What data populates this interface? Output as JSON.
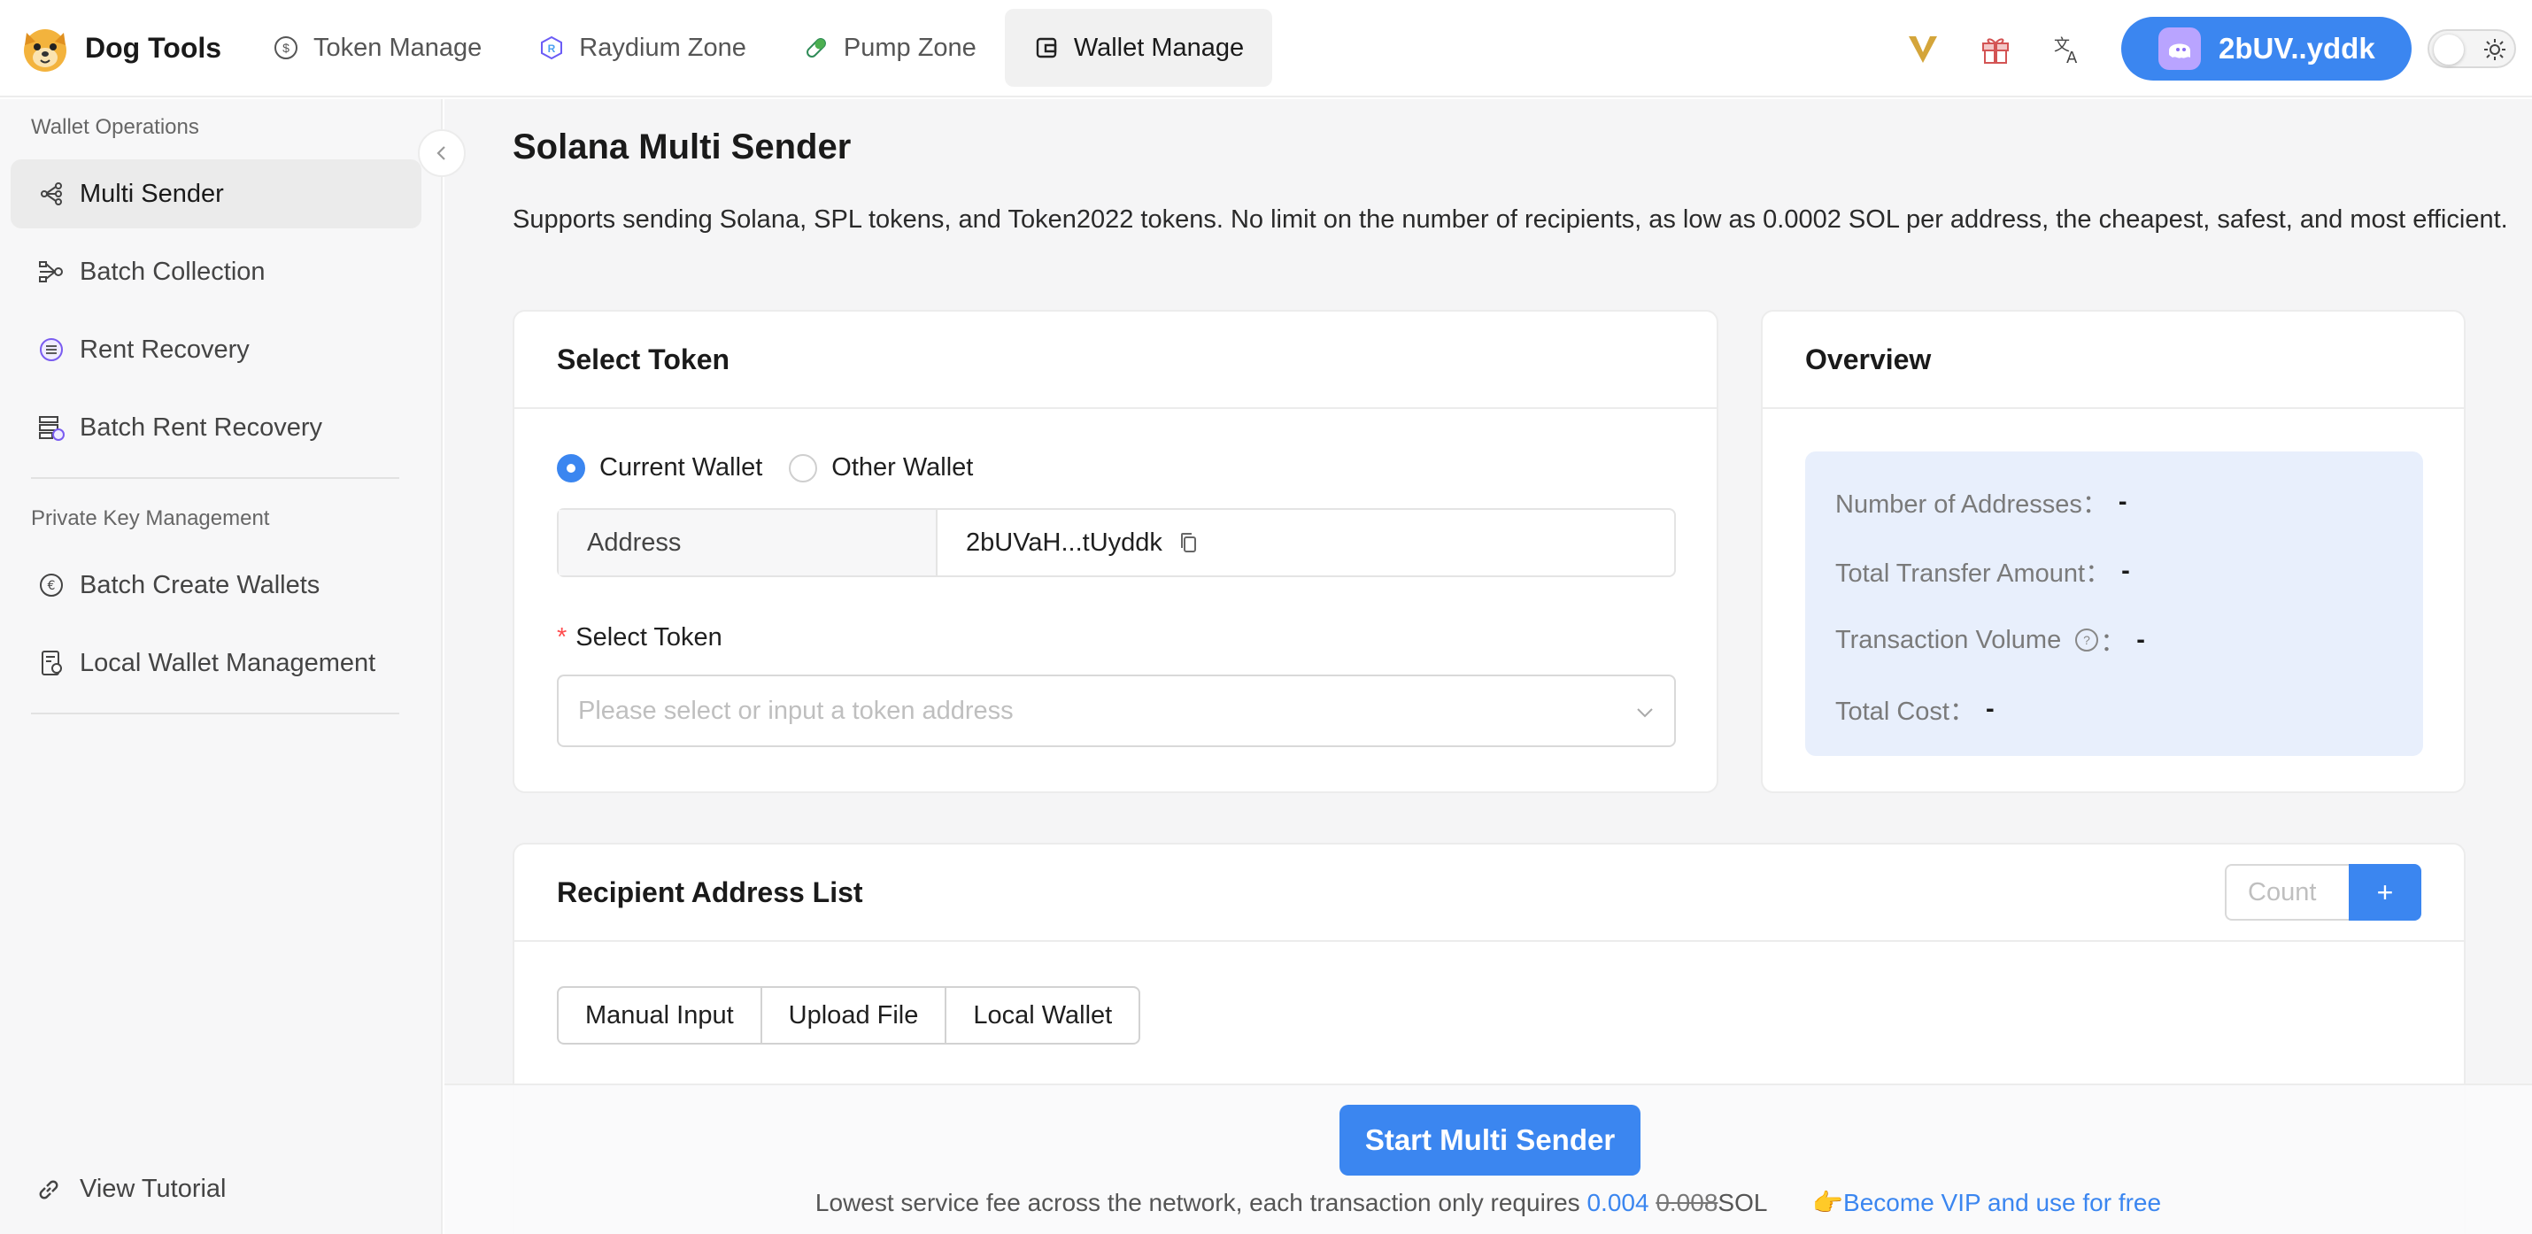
{
  "app": {
    "name": "Dog Tools"
  },
  "nav": [
    {
      "label": "Token Manage",
      "icon": "dollar-icon"
    },
    {
      "label": "Raydium Zone",
      "icon": "raydium-icon"
    },
    {
      "label": "Pump Zone",
      "icon": "pill-icon"
    },
    {
      "label": "Wallet Manage",
      "icon": "wallet-icon",
      "active": true
    }
  ],
  "header": {
    "wallet_label": "2bUV..yddk",
    "icons": [
      "vip-icon",
      "gift-icon",
      "translate-icon"
    ],
    "theme_toggle": "light"
  },
  "sidebar": {
    "section_ops": "Wallet Operations",
    "ops": [
      {
        "label": "Multi Sender",
        "icon": "share-nodes-icon",
        "active": true
      },
      {
        "label": "Batch Collection",
        "icon": "merge-icon"
      },
      {
        "label": "Rent Recovery",
        "icon": "recovery-icon"
      },
      {
        "label": "Batch Rent Recovery",
        "icon": "stack-icon"
      }
    ],
    "section_keys": "Private Key Management",
    "keys": [
      {
        "label": "Batch Create Wallets",
        "icon": "euro-icon"
      },
      {
        "label": "Local Wallet Management",
        "icon": "wallet-doc-icon"
      }
    ],
    "tutorial": "View Tutorial"
  },
  "page": {
    "title": "Solana Multi Sender",
    "description": "Supports sending Solana, SPL tokens, and Token2022 tokens. No limit on the number of recipients, as low as 0.0002 SOL per address, the cheapest, safest, and most efficient."
  },
  "select_token": {
    "title": "Select Token",
    "radio_current": "Current Wallet",
    "radio_other": "Other Wallet",
    "selected": "Current Wallet",
    "address_label": "Address",
    "address_value": "2bUVaH...tUyddk",
    "token_label": "Select Token",
    "token_placeholder": "Please select or input a token address"
  },
  "overview": {
    "title": "Overview",
    "rows": [
      {
        "label": "Number of Addresses：",
        "value": "-"
      },
      {
        "label": "Total Transfer Amount：",
        "value": "-"
      },
      {
        "label": "Transaction Volume",
        "suffix": "：",
        "value": "-"
      },
      {
        "label": "Total Cost：",
        "value": "-"
      }
    ]
  },
  "recipients": {
    "title": "Recipient Address List",
    "count_placeholder": "Count",
    "add_label": "+",
    "tabs": [
      "Manual Input",
      "Upload File",
      "Local Wallet"
    ]
  },
  "footer": {
    "start_label": "Start Multi Sender",
    "fee_text": "Lowest service fee across the network, each transaction only requires",
    "price": "0.004",
    "old_price": "0.008",
    "unit": "SOL",
    "vip_text": "👉Become VIP and use for free"
  },
  "colors": {
    "accent": "#3b86f0",
    "overview_bg": "#e8effc",
    "required": "#ff4d4f"
  }
}
